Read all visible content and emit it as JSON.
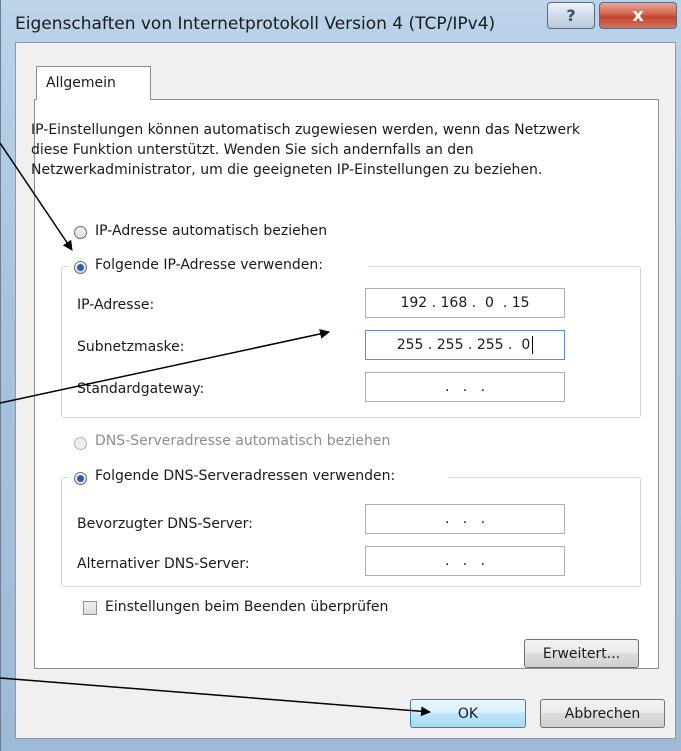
{
  "window": {
    "title": "Eigenschaften von Internetprotokoll Version 4 (TCP/IPv4)",
    "help_label": "?",
    "close_label": "x"
  },
  "tab": {
    "label": "Allgemein"
  },
  "intro_text": "IP-Einstellungen können automatisch zugewiesen werden, wenn das Netzwerk diese Funktion unterstützt. Wenden Sie sich andernfalls an den Netzwerkadministrator, um die geeigneten IP-Einstellungen zu beziehen.",
  "ip": {
    "auto_label": "IP-Adresse automatisch beziehen",
    "manual_label": "Folgende IP-Adresse verwenden:",
    "selected": "manual",
    "fields": [
      {
        "label": "IP-Adresse:",
        "value": "192 . 168 .  0  . 15"
      },
      {
        "label": "Subnetzmaske:",
        "value": "255 . 255 . 255 .  0"
      },
      {
        "label": "Standardgateway:",
        "value": " .   .   . "
      }
    ]
  },
  "dns": {
    "auto_label": "DNS-Serveradresse automatisch beziehen",
    "manual_label": "Folgende DNS-Serveradressen verwenden:",
    "selected": "manual",
    "fields": [
      {
        "label": "Bevorzugter DNS-Server:",
        "value": " .   .   . "
      },
      {
        "label": "Alternativer DNS-Server:",
        "value": " .   .   . "
      }
    ]
  },
  "validate_label": "Einstellungen beim Beenden überprüfen",
  "validate_checked": false,
  "buttons": {
    "advanced": "Erweitert...",
    "ok": "OK",
    "cancel": "Abbrechen"
  }
}
